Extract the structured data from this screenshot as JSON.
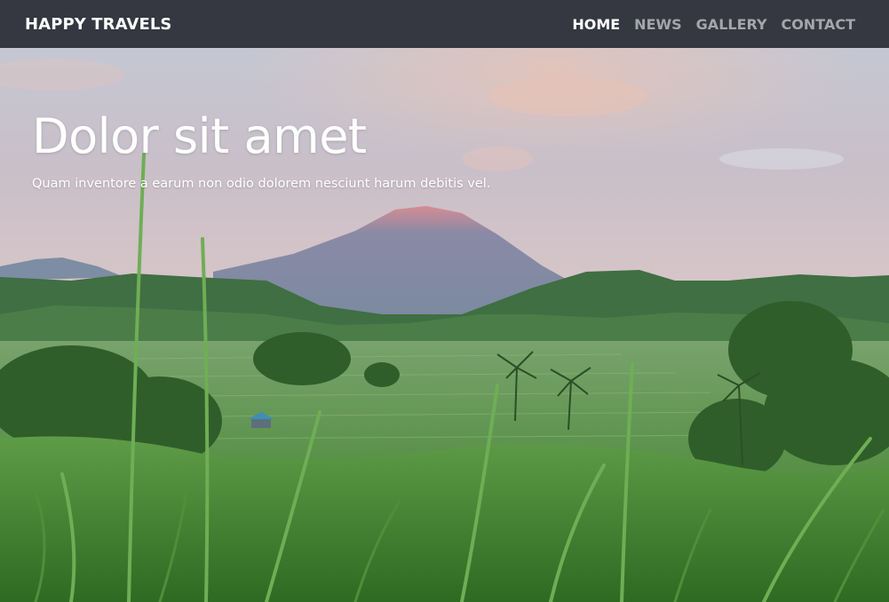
{
  "nav": {
    "brand": "HAPPY TRAVELS",
    "links": [
      {
        "label": "HOME",
        "active": true
      },
      {
        "label": "NEWS",
        "active": false
      },
      {
        "label": "GALLERY",
        "active": false
      },
      {
        "label": "CONTACT",
        "active": false
      }
    ]
  },
  "hero": {
    "title": "Dolor sit amet",
    "subtitle": "Quam inventore a earum non odio dolorem nesciunt harum debitis vel."
  },
  "colors": {
    "navbar_bg": "#353841",
    "nav_active": "#ffffff",
    "nav_inactive": "#a3a6ad",
    "sky": "#b9bfce",
    "grass": "#3f7d2c"
  }
}
